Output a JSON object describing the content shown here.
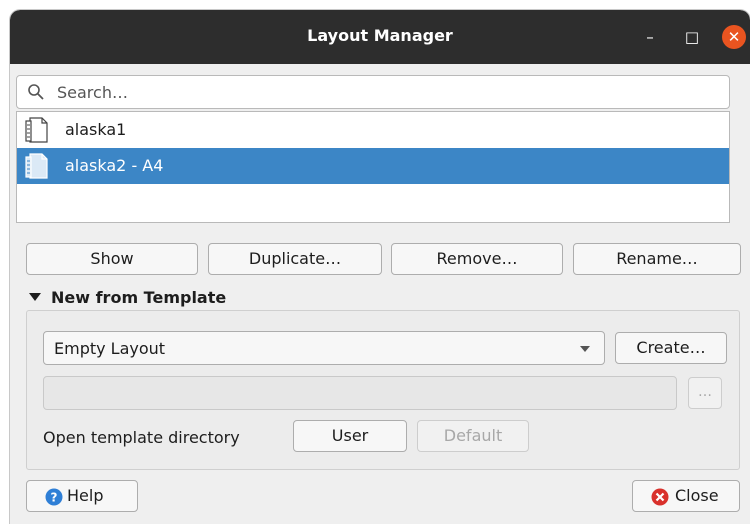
{
  "window": {
    "title": "Layout Manager",
    "minimize_glyph": "–",
    "maximize_glyph": "□",
    "close_glyph": "✕"
  },
  "search": {
    "placeholder": "Search…",
    "value": ""
  },
  "layouts": [
    {
      "name": "alaska1",
      "icon": "layout-page-icon",
      "selected": false
    },
    {
      "name": "alaska2 - A4",
      "icon": "layout-page-icon",
      "selected": true
    }
  ],
  "actions": {
    "show": "Show",
    "duplicate": "Duplicate…",
    "remove": "Remove…",
    "rename": "Rename…"
  },
  "template": {
    "section_title": "New from Template",
    "selected": "Empty Layout",
    "create": "Create…",
    "path_value": "",
    "browse": "…",
    "open_dir_label": "Open template directory",
    "user": "User",
    "default": "Default"
  },
  "footer": {
    "help": "Help",
    "close": "Close"
  },
  "colors": {
    "titlebar": "#2d2d2d",
    "close_accent": "#e95420",
    "selection": "#3c86c6",
    "help_icon": "#2f7fd6",
    "close_icon": "#d9312c"
  }
}
